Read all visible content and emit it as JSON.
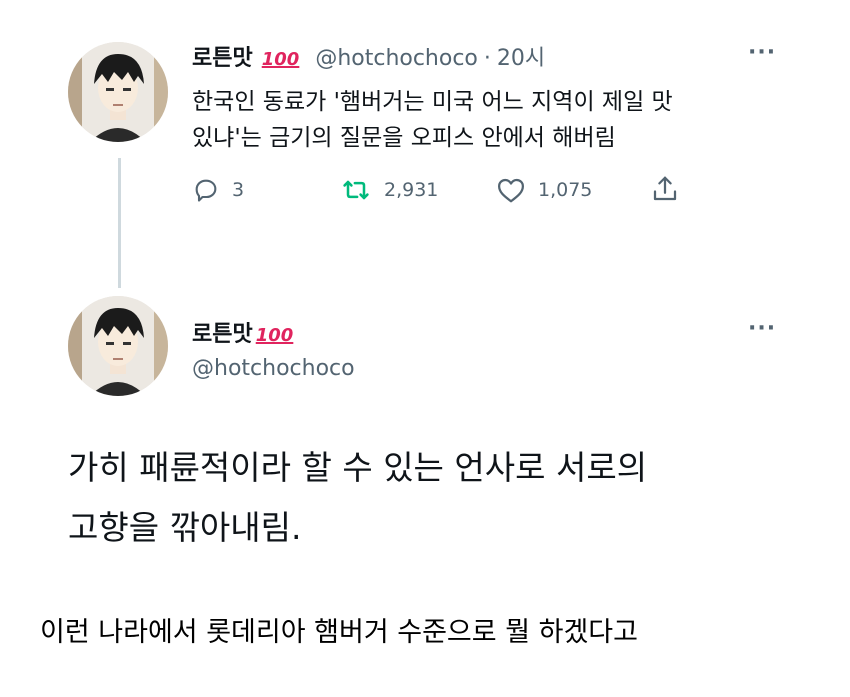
{
  "tweet1": {
    "display_name": "로튼맛",
    "badge": "💯",
    "handle": "@hotchochoco",
    "separator": "·",
    "time": "20시",
    "more": "···",
    "text_line1": "한국인 동료가 '햄버거는 미국 어느 지역이 제일 맛",
    "text_line2": "있냐'는 금기의 질문을 오피스 안에서 해버림",
    "replies": "3",
    "retweets": "2,931",
    "likes": "1,075"
  },
  "tweet2": {
    "display_name": "로튼맛",
    "badge": "💯",
    "handle": "@hotchochoco",
    "more": "···",
    "text_line1": "가히 패륜적이라 할 수 있는 언사로 서로의",
    "text_line2": "고향을 깎아내림."
  },
  "caption": "이런 나라에서 롯데리아 햄버거 수준으로 뭘 하겠다고",
  "colors": {
    "text": "#0f1419",
    "muted": "#536471",
    "retweet_green": "#00ba7c",
    "thread_line": "#cfd9de"
  },
  "icons": [
    "reply-icon",
    "retweet-icon",
    "like-icon",
    "share-icon",
    "more-icon"
  ]
}
